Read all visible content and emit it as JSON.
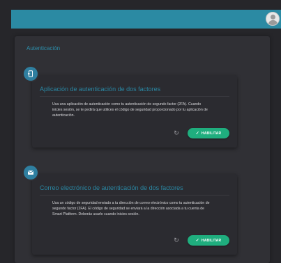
{
  "section": {
    "title": "Autenticación"
  },
  "cards": [
    {
      "title": "Aplicación de autenticación de dos factores",
      "description": "Usa una aplicación de autenticación como tu autenticación de segundo factor (2FA). Cuando inicies sesión, se te pedirá que utilices el código de seguridad proporcionado por tu aplicación de autenticación.",
      "icon": "phone-icon",
      "button_label": "HABILITAR"
    },
    {
      "title": "Correo electrónico de autenticación de dos factores",
      "description": "Usa un código de seguridad enviado a tu dirección de correo electrónico como tu autenticación de segundo factor (2FA). El código de seguridad se enviará a la dirección asociada a tu cuenta de Smart Platform. Deberás usarlo cuando inicies sesión.",
      "icon": "email-icon",
      "button_label": "HABILITAR"
    }
  ],
  "colors": {
    "accent": "#2b8aa3",
    "success": "#1fae7e",
    "background": "#26262a"
  }
}
